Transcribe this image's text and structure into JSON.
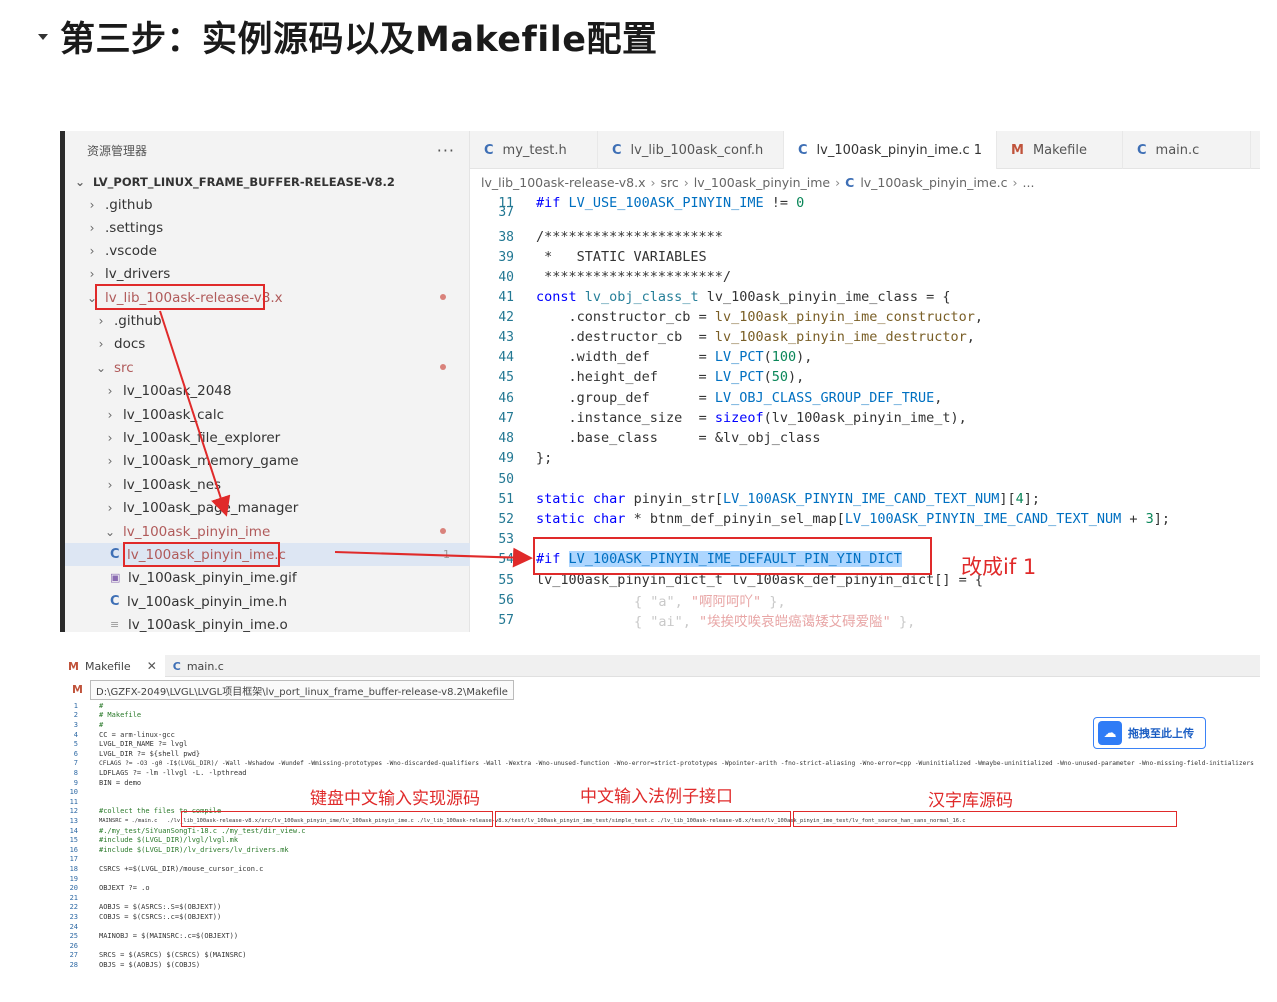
{
  "heading": {
    "title": "第三步：实例源码以及Makefile配置"
  },
  "vscode": {
    "explorer": {
      "header": "资源管理器",
      "more": "···",
      "root": "LV_PORT_LINUX_FRAME_BUFFER-RELEASE-V8.2",
      "items": [
        {
          "label": ".github"
        },
        {
          "label": ".settings"
        },
        {
          "label": ".vscode"
        },
        {
          "label": "lv_drivers"
        },
        {
          "label": "lv_lib_100ask-release-v8.x"
        },
        {
          "label": ".github"
        },
        {
          "label": "docs"
        },
        {
          "label": "src"
        },
        {
          "label": "lv_100ask_2048"
        },
        {
          "label": "lv_100ask_calc"
        },
        {
          "label": "lv_100ask_file_explorer"
        },
        {
          "label": "lv_100ask_memory_game"
        },
        {
          "label": "lv_100ask_nes"
        },
        {
          "label": "lv_100ask_page_manager"
        },
        {
          "label": "lv_100ask_pinyin_ime"
        },
        {
          "label": "lv_100ask_pinyin_ime.c",
          "badge": "1"
        },
        {
          "label": "lv_100ask_pinyin_ime.gif"
        },
        {
          "label": "lv_100ask_pinyin_ime.h"
        },
        {
          "label": "lv_100ask_pinyin_ime.o"
        }
      ]
    },
    "tabs": [
      {
        "icon": "C",
        "label": "my_test.h"
      },
      {
        "icon": "C",
        "label": "lv_lib_100ask_conf.h"
      },
      {
        "icon": "C",
        "label": "lv_100ask_pinyin_ime.c 1"
      },
      {
        "icon": "M",
        "label": "Makefile"
      },
      {
        "icon": "C",
        "label": "main.c"
      }
    ],
    "breadcrumb": [
      "lv_lib_100ask-release-v8.x",
      "src",
      "lv_100ask_pinyin_ime",
      "lv_100ask_pinyin_ime.c",
      "..."
    ],
    "code": {
      "l11_num": "11",
      "l37_num": "37",
      "l38_num": "38",
      "l39_num": "39",
      "l40_num": "40",
      "l41_num": "41",
      "l42_num": "42",
      "l43_num": "43",
      "l44_num": "44",
      "l45_num": "45",
      "l46_num": "46",
      "l47_num": "47",
      "l48_num": "48",
      "l49_num": "49",
      "l50_num": "50",
      "l51_num": "51",
      "l52_num": "52",
      "l53_num": "53",
      "l54_num": "54",
      "l55_num": "55",
      "l56_num": "56",
      "l57_num": "57",
      "l11_kw": "#if",
      "l11_mac": "LV_USE_100ASK_PINYIN_IME",
      "l11_op": " != ",
      "l11_num_val": "0",
      "l38": "/**********************",
      "l39": " *   STATIC VARIABLES",
      "l40": " **********************/",
      "l41_a": "const",
      "l41_b": "lv_obj_class_t",
      "l41_c": "lv_100ask_pinyin_ime_class",
      "l41_d": " = {",
      "l42_a": "    .constructor_cb",
      "l42_b": " = ",
      "l42_c": "lv_100ask_pinyin_ime_constructor",
      "l42_d": ",",
      "l43_a": "    .destructor_cb",
      "l43_b": "  = ",
      "l43_c": "lv_100ask_pinyin_ime_destructor",
      "l43_d": ",",
      "l44_a": "    .width_def",
      "l44_b": "      = ",
      "l44_c": "LV_PCT",
      "l44_d": "(",
      "l44_e": "100",
      "l44_f": "),",
      "l45_a": "    .height_def",
      "l45_b": "     = ",
      "l45_c": "LV_PCT",
      "l45_d": "(",
      "l45_e": "50",
      "l45_f": "),",
      "l46_a": "    .group_def",
      "l46_b": "      = ",
      "l46_c": "LV_OBJ_CLASS_GROUP_DEF_TRUE",
      "l46_d": ",",
      "l47_a": "    .instance_size",
      "l47_b": "  = ",
      "l47_c": "sizeof",
      "l47_d": "(lv_100ask_pinyin_ime_t),",
      "l48_a": "    .base_class",
      "l48_b": "     = ",
      "l48_c": "&lv_obj_class",
      "l49": "};",
      "l51_a": "static",
      "l51_b": "char",
      "l51_c": " pinyin_str[",
      "l51_d": "LV_100ASK_PINYIN_IME_CAND_TEXT_NUM",
      "l51_e": "][",
      "l51_f": "4",
      "l51_g": "];",
      "l52_a": "static",
      "l52_b": "char",
      "l52_c": " * btnm_def_pinyin_sel_map[",
      "l52_d": "LV_100ASK_PINYIN_IME_CAND_TEXT_NUM",
      "l52_e": " + ",
      "l52_f": "3",
      "l52_g": "];",
      "l54_kw": "#if",
      "l54_mac": "LV_100ASK_PINYIN_IME_DEFAULT_PIN_YIN_DICT",
      "l55": "lv_100ask_pinyin_dict_t lv_100ask_def_pinyin_dict[] = {",
      "l56_a": "{ ",
      "l56_b": "\"a\"",
      "l56_c": ", ",
      "l56_d": "\"啊阿呵吖\"",
      "l56_e": " },",
      "l57_a": "{ ",
      "l57_b": "\"ai\"",
      "l57_c": ", ",
      "l57_d": "\"埃挨哎唉哀皑癌蔼矮艾碍爱隘\"",
      "l57_e": " },"
    },
    "annotation": "改成if 1"
  },
  "editor": {
    "tabs": [
      {
        "icon": "M",
        "label": "Makefile",
        "close": "✕"
      },
      {
        "icon": "C",
        "label": "main.c"
      }
    ],
    "path_icon": "M",
    "path": "D:\\GZFX-2049\\LVGL\\LVGL项目框架\\lv_port_linux_frame_buffer-release-v8.2\\Makefile",
    "upload_label": "拖拽至此上传",
    "lines": [
      {
        "n": "1",
        "t": "#"
      },
      {
        "n": "2",
        "t": "# Makefile"
      },
      {
        "n": "3",
        "t": "#"
      },
      {
        "n": "4",
        "t": "CC = arm-linux-gcc"
      },
      {
        "n": "5",
        "t": "LVGL_DIR_NAME ?= lvgl"
      },
      {
        "n": "6",
        "t": "LVGL_DIR ?= ${shell pwd}"
      },
      {
        "n": "7",
        "t": "CFLAGS ?= -O3 -g0 -I$(LVGL_DIR)/ -Wall -Wshadow -Wundef -Wmissing-prototypes -Wno-discarded-qualifiers -Wall -Wextra -Wno-unused-function -Wno-error=strict-prototypes -Wpointer-arith -fno-strict-aliasing -Wno-error=cpp -Wuninitialized -Wmaybe-uninitialized -Wno-unused-parameter -Wno-missing-field-initializers"
      },
      {
        "n": "8",
        "t": "LDFLAGS ?= -lm -llvgl -L. -lpthread"
      },
      {
        "n": "9",
        "t": "BIN = demo"
      },
      {
        "n": "10",
        "t": ""
      },
      {
        "n": "11",
        "t": ""
      },
      {
        "n": "12",
        "t": "#collect the files to compile"
      },
      {
        "n": "13",
        "t": "MAINSRC = ./main.c   ./lv_lib_100ask-release-v8.x/src/lv_100ask_pinyin_ime/lv_100ask_pinyin_ime.c ./lv_lib_100ask-release-v8.x/test/lv_100ask_pinyin_ime_test/simple_test.c ./lv_lib_100ask-release-v8.x/test/lv_100ask_pinyin_ime_test/lv_font_source_han_sans_normal_16.c"
      },
      {
        "n": "14",
        "t": "#./my_test/SiYuanSongTi-18.c ./my_test/dir_view.c"
      },
      {
        "n": "15",
        "t": "#include $(LVGL_DIR)/lvgl/lvgl.mk"
      },
      {
        "n": "16",
        "t": "#include $(LVGL_DIR)/lv_drivers/lv_drivers.mk"
      },
      {
        "n": "17",
        "t": ""
      },
      {
        "n": "18",
        "t": "CSRCS +=$(LVGL_DIR)/mouse_cursor_icon.c"
      },
      {
        "n": "19",
        "t": ""
      },
      {
        "n": "20",
        "t": "OBJEXT ?= .o"
      },
      {
        "n": "21",
        "t": ""
      },
      {
        "n": "22",
        "t": "AOBJS = $(ASRCS:.S=$(OBJEXT))"
      },
      {
        "n": "23",
        "t": "COBJS = $(CSRCS:.c=$(OBJEXT))"
      },
      {
        "n": "24",
        "t": ""
      },
      {
        "n": "25",
        "t": "MAINOBJ = $(MAINSRC:.c=$(OBJEXT))"
      },
      {
        "n": "26",
        "t": ""
      },
      {
        "n": "27",
        "t": "SRCS = $(ASRCS) $(CSRCS) $(MAINSRC)"
      },
      {
        "n": "28",
        "t": "OBJS = $(AOBJS) $(COBJS)"
      }
    ],
    "annotations": [
      "键盘中文输入实现源码",
      "中文输入法例子接口",
      "汉字库源码"
    ]
  },
  "colors": {
    "annotation_red": "#e02a2a",
    "keyword_blue": "#0000ff",
    "selection": "#add6ff"
  }
}
